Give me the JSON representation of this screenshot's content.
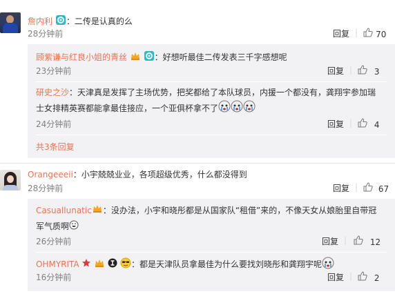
{
  "comments": [
    {
      "user": "詹内利",
      "text": "：二传是认真的么",
      "time": "28分钟前",
      "reply": "回复",
      "likes": "70",
      "replies": [
        {
          "user": "顾紫谦与红良小姐的青丝",
          "text": "：好想听最佳二传发表三千字感想呢",
          "time": "23分钟前",
          "reply": "回复",
          "likes": "3"
        },
        {
          "user": "研史之沙",
          "text_line1": "：天津真是发挥了主场优势，把奖都给了本队球员，内援一个都没有，龚翔宇参加瑞",
          "text_line2": "士女排精英赛都能拿最佳接应，一个亚俱杯拿不了",
          "time": "24分钟前",
          "reply": "回复",
          "likes": "4"
        }
      ],
      "more": "共3条回复"
    },
    {
      "user": "Orangeeeii",
      "text": "：小宇兢兢业业，各项超级优秀，什么都没得到",
      "time": "28分钟前",
      "reply": "回复",
      "likes": "67",
      "replies": [
        {
          "user": "Casuallunatic",
          "text_line1": "：没办法，小宇和晓彤都是从国家队“租借”来的，不像天女从娘胎里自带冠",
          "text_line2": "军气质啊",
          "time": "26分钟前",
          "reply": "回复",
          "likes": "12"
        },
        {
          "user": "OHMYRITA",
          "text": "：都是天津队员拿最佳为什么要找刘晓彤和龚翔宇呢",
          "time": "16分钟前",
          "reply": "回复",
          "likes": "2"
        }
      ]
    }
  ],
  "colors": {
    "username": "#eb7350",
    "text": "#333333",
    "muted": "#808080",
    "reply_bg": "#f2f2f5"
  }
}
